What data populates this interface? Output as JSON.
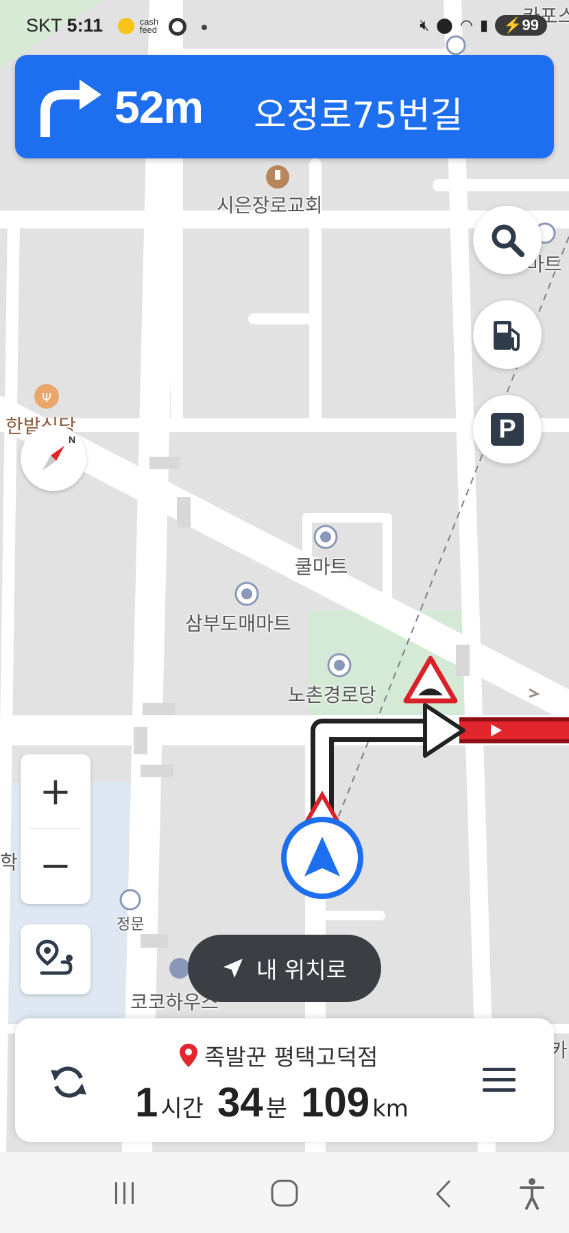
{
  "status_bar": {
    "carrier": "SKT",
    "time": "5:11",
    "cashfeed_line1": "cash",
    "cashfeed_line2": "feed",
    "battery": "99"
  },
  "guidance": {
    "distance": "52m",
    "road_name": "오정로75번길",
    "turn_direction": "right"
  },
  "map_labels": {
    "church": "시은장로교회",
    "restaurant": "한밭식당",
    "mart1": "쿨마트",
    "mart2": "삼부도매마트",
    "senior_center": "노촌경로당",
    "gate": "정문",
    "house": "코코하우스",
    "edge_top_right": "카포스",
    "edge_right": "마트",
    "edge_left": "학",
    "edge_right_bottom": "카"
  },
  "controls": {
    "zoom_in": "+",
    "zoom_out": "−",
    "my_location": "내 위치로"
  },
  "trip": {
    "destination": "족발꾼 평택고덕점",
    "hours": "1",
    "hours_unit": "시간",
    "minutes": "34",
    "minutes_unit": "분",
    "distance": "109",
    "distance_unit": "km"
  },
  "colors": {
    "banner": "#1e6ff0",
    "route_red": "#d8222a",
    "route_dark": "#2a2a2a",
    "map_bg": "#e4e4e4",
    "park": "#d6ead6"
  }
}
